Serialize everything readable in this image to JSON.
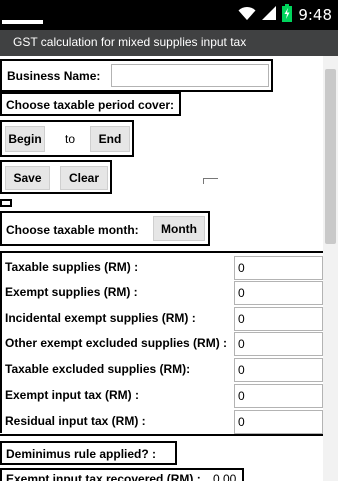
{
  "status_bar": {
    "time": "9:48",
    "icons": [
      "wifi-icon",
      "signal-icon",
      "battery-icon"
    ]
  },
  "app": {
    "title": "GST calculation for mixed supplies input tax"
  },
  "business": {
    "label": "Business Name:",
    "value": ""
  },
  "period": {
    "label": "Choose taxable period cover:",
    "begin_label": "Begin",
    "to_label": "to",
    "end_label": "End"
  },
  "actions": {
    "save_label": "Save",
    "clear_label": "Clear"
  },
  "month": {
    "label": "Choose taxable month:",
    "button_label": "Month"
  },
  "fields": [
    {
      "label": "Taxable supplies (RM) :",
      "value": "0"
    },
    {
      "label": "Exempt supplies (RM) :",
      "value": "0"
    },
    {
      "label": "Incidental exempt supplies (RM) :",
      "value": "0"
    },
    {
      "label": "Other exempt excluded supplies (RM) :",
      "value": "0"
    },
    {
      "label": "Taxable excluded supplies (RM):",
      "value": "0"
    },
    {
      "label": "Exempt input tax (RM) :",
      "value": "0"
    },
    {
      "label": "Residual input tax (RM) :",
      "value": "0"
    }
  ],
  "deminimus": {
    "label": "Deminimus rule applied? :"
  },
  "exempt_recovered": {
    "label": "Exempt input tax recovered (RM) :",
    "value": "0.00"
  },
  "colors": {
    "status_bar": "#000000",
    "title_bar": "#404142",
    "accent_green": "#00d45c",
    "button_bg": "#e6e6e6"
  }
}
